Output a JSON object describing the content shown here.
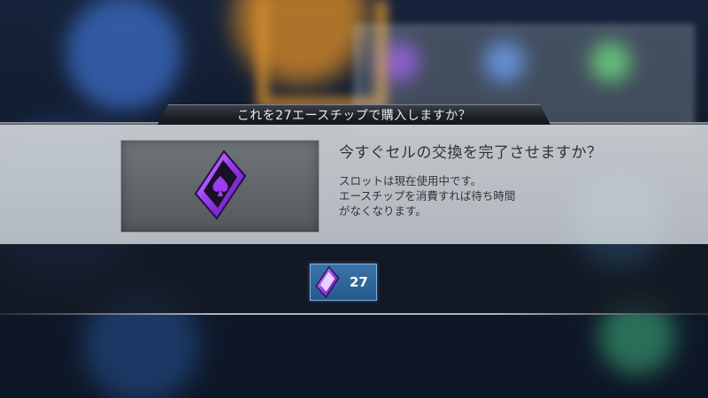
{
  "dialog": {
    "title": "これを27エースチップで購入しますか？",
    "heading": "今すぐセルの交換を完了させますか？",
    "body_lines": [
      "スロットは現在使用中です。",
      "エースチップを消費すれば待ち時間",
      "がなくなります。"
    ]
  },
  "purchase": {
    "price": "27",
    "currency_icon": "ace-chip-icon"
  },
  "colors": {
    "chip_purple": "#8a2be2",
    "button_blue": "#2e679b",
    "dialog_bg": "#c9ced2"
  }
}
